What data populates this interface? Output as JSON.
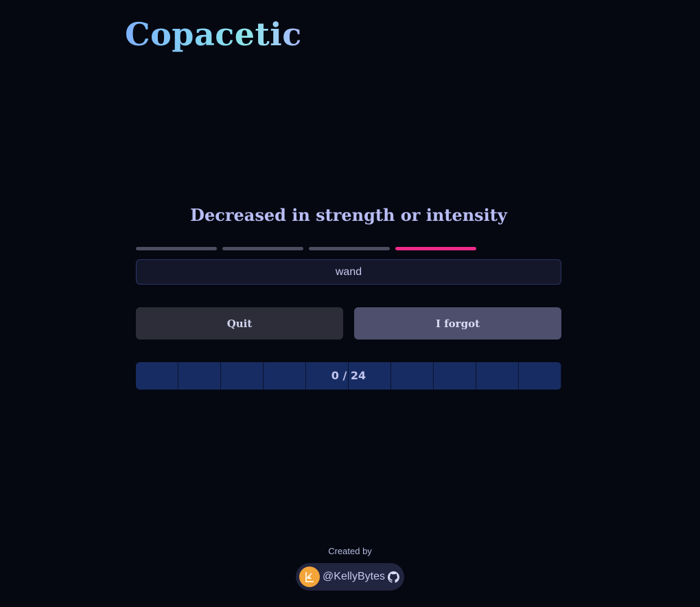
{
  "app": {
    "title": "Copacetic"
  },
  "quiz": {
    "prompt": "Decreased in strength or intensity",
    "hints": {
      "total": 4,
      "active_index": 3
    },
    "answer_value": "wand",
    "buttons": {
      "quit": "Quit",
      "forgot": "I forgot"
    },
    "progress": {
      "label": "0 / 24",
      "segments": 10
    }
  },
  "footer": {
    "created_by": "Created by",
    "author": "@KellyBytes"
  },
  "colors": {
    "background": "#050811",
    "hint_inactive": "#4c4e60",
    "hint_active": "#ee2b8a",
    "progress_fill": "#172c62",
    "avatar": "#f3a53a"
  },
  "icons": {
    "avatar": "kellybytes-avatar-icon",
    "github": "github-icon"
  }
}
